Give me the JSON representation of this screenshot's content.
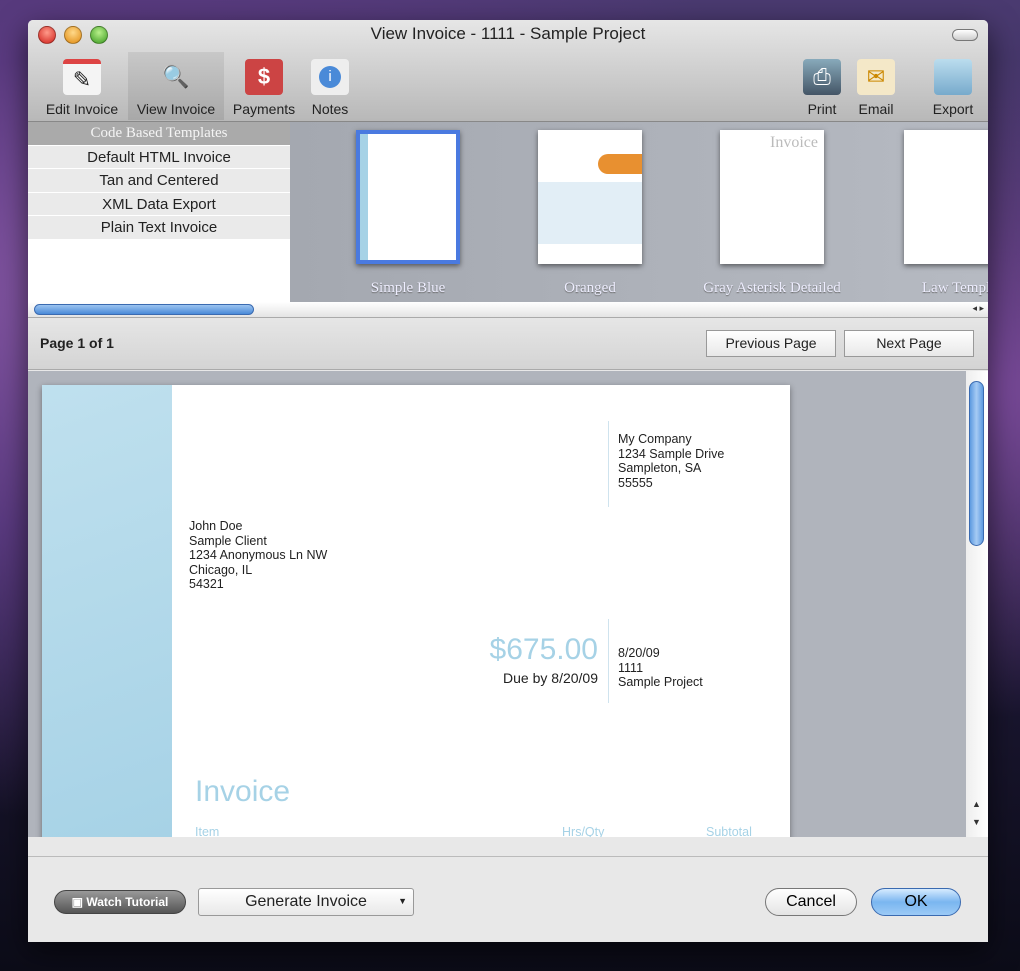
{
  "window": {
    "title": "View Invoice - 1111 - Sample Project"
  },
  "toolbar": {
    "edit_invoice": "Edit Invoice",
    "view_invoice": "View Invoice",
    "payments": "Payments",
    "notes": "Notes",
    "print": "Print",
    "email": "Email",
    "export": "Export"
  },
  "template_list": {
    "header": "Code Based Templates",
    "items": [
      "Default HTML Invoice",
      "Tan and Centered",
      "XML Data Export",
      "Plain Text Invoice"
    ]
  },
  "templates": [
    "Simple Blue",
    "Oranged",
    "Gray Asterisk Detailed",
    "Law Templ"
  ],
  "thumb_text": {
    "gray_title": "Invoice"
  },
  "pager": {
    "page_label": "Page 1 of 1",
    "previous": "Previous Page",
    "next": "Next Page"
  },
  "invoice": {
    "company": [
      "My Company",
      "1234 Sample Drive",
      "Sampleton, SA",
      "55555"
    ],
    "client": [
      "John Doe",
      "Sample Client",
      "1234 Anonymous Ln NW",
      "Chicago, IL",
      "54321"
    ],
    "amount": "$675.00",
    "due": "Due by 8/20/09",
    "meta": [
      "8/20/09",
      "1111",
      "Sample Project"
    ],
    "heading": "Invoice",
    "columns": [
      "Item",
      "Hrs/Qty",
      "Subtotal"
    ]
  },
  "footer": {
    "watch_tutorial": "Watch Tutorial",
    "generate": "Generate Invoice",
    "cancel": "Cancel",
    "ok": "OK"
  }
}
